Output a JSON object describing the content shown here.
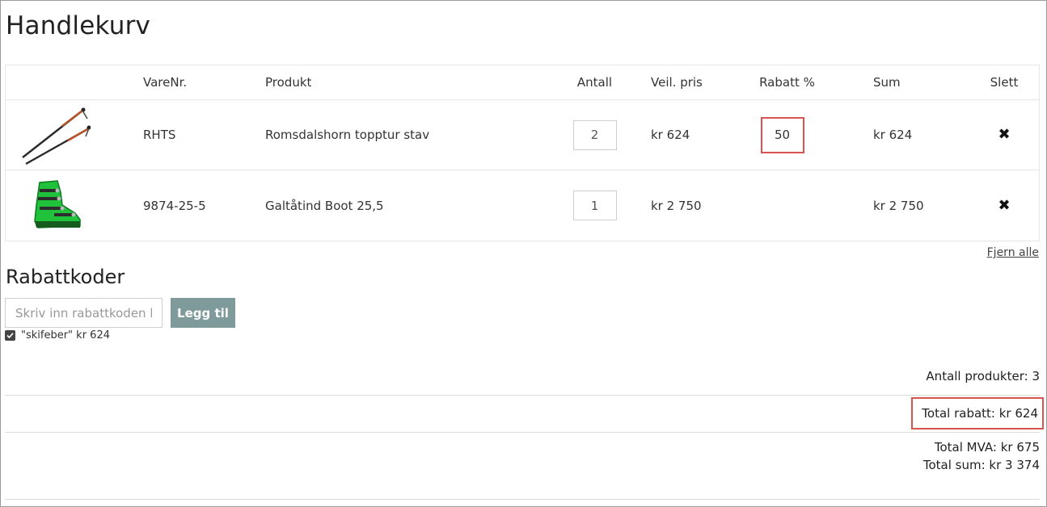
{
  "page_title": "Handlekurv",
  "table": {
    "headers": {
      "item_no": "VareNr.",
      "product": "Produkt",
      "quantity": "Antall",
      "list_price": "Veil. pris",
      "discount_pct": "Rabatt %",
      "sum": "Sum",
      "delete": "Slett"
    },
    "rows": [
      {
        "image_icon": "ski-poles-image",
        "item_no": "RHTS",
        "product": "Romsdalshorn topptur stav",
        "quantity": "2",
        "list_price": "kr 624",
        "discount_pct": "50",
        "sum": "kr 624"
      },
      {
        "image_icon": "ski-boot-image",
        "item_no": "9874-25-5",
        "product": "Galtåtind Boot 25,5",
        "quantity": "1",
        "list_price": "kr 2 750",
        "discount_pct": "",
        "sum": "kr 2 750"
      }
    ],
    "delete_icon": "close-icon"
  },
  "clear_all_label": "Fjern alle",
  "discount_codes": {
    "title": "Rabattkoder",
    "input_placeholder": "Skriv inn rabattkoden her",
    "add_button_label": "Legg til",
    "applied_code": "\"skifeber\" kr 624",
    "applied_checked": true
  },
  "summary": {
    "product_count": "Antall produkter: 3",
    "total_discount": "Total rabatt: kr 624",
    "total_vat": "Total MVA: kr 675",
    "total_sum": "Total sum: kr 3 374"
  },
  "colors": {
    "highlight_border": "#d9534f",
    "add_button_bg": "#7f9a9a"
  }
}
